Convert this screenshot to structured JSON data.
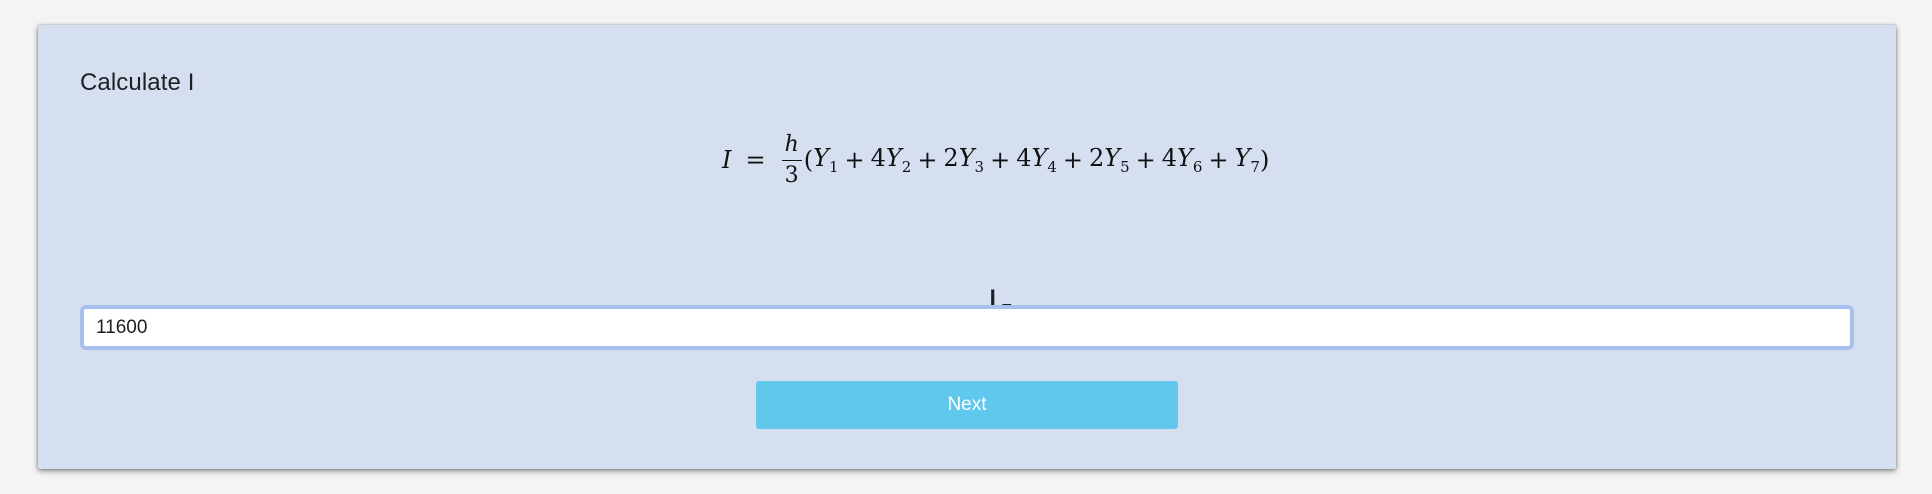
{
  "card": {
    "heading": "Calculate I"
  },
  "formula": {
    "lhs": "I",
    "eq": "=",
    "frac_num": "h",
    "frac_den": "3",
    "open_paren": "(",
    "close_paren": ")",
    "terms": [
      {
        "coef": "",
        "var": "Y",
        "sub": "1"
      },
      {
        "op": "+",
        "coef": "4",
        "var": "Y",
        "sub": "2"
      },
      {
        "op": "+",
        "coef": "2",
        "var": "Y",
        "sub": "3"
      },
      {
        "op": "+",
        "coef": "4",
        "var": "Y",
        "sub": "4"
      },
      {
        "op": "+",
        "coef": "2",
        "var": "Y",
        "sub": "5"
      },
      {
        "op": "+",
        "coef": "4",
        "var": "Y",
        "sub": "6"
      },
      {
        "op": "+",
        "coef": "",
        "var": "Y",
        "sub": "7"
      }
    ]
  },
  "answer": {
    "label_var": "I",
    "label_eq": "=",
    "value": "11600"
  },
  "next_button": {
    "label": "Next"
  },
  "colors": {
    "card_bg": "#d6dff0",
    "button_bg": "#5fc8ec",
    "input_border": "#a8c0ee"
  }
}
